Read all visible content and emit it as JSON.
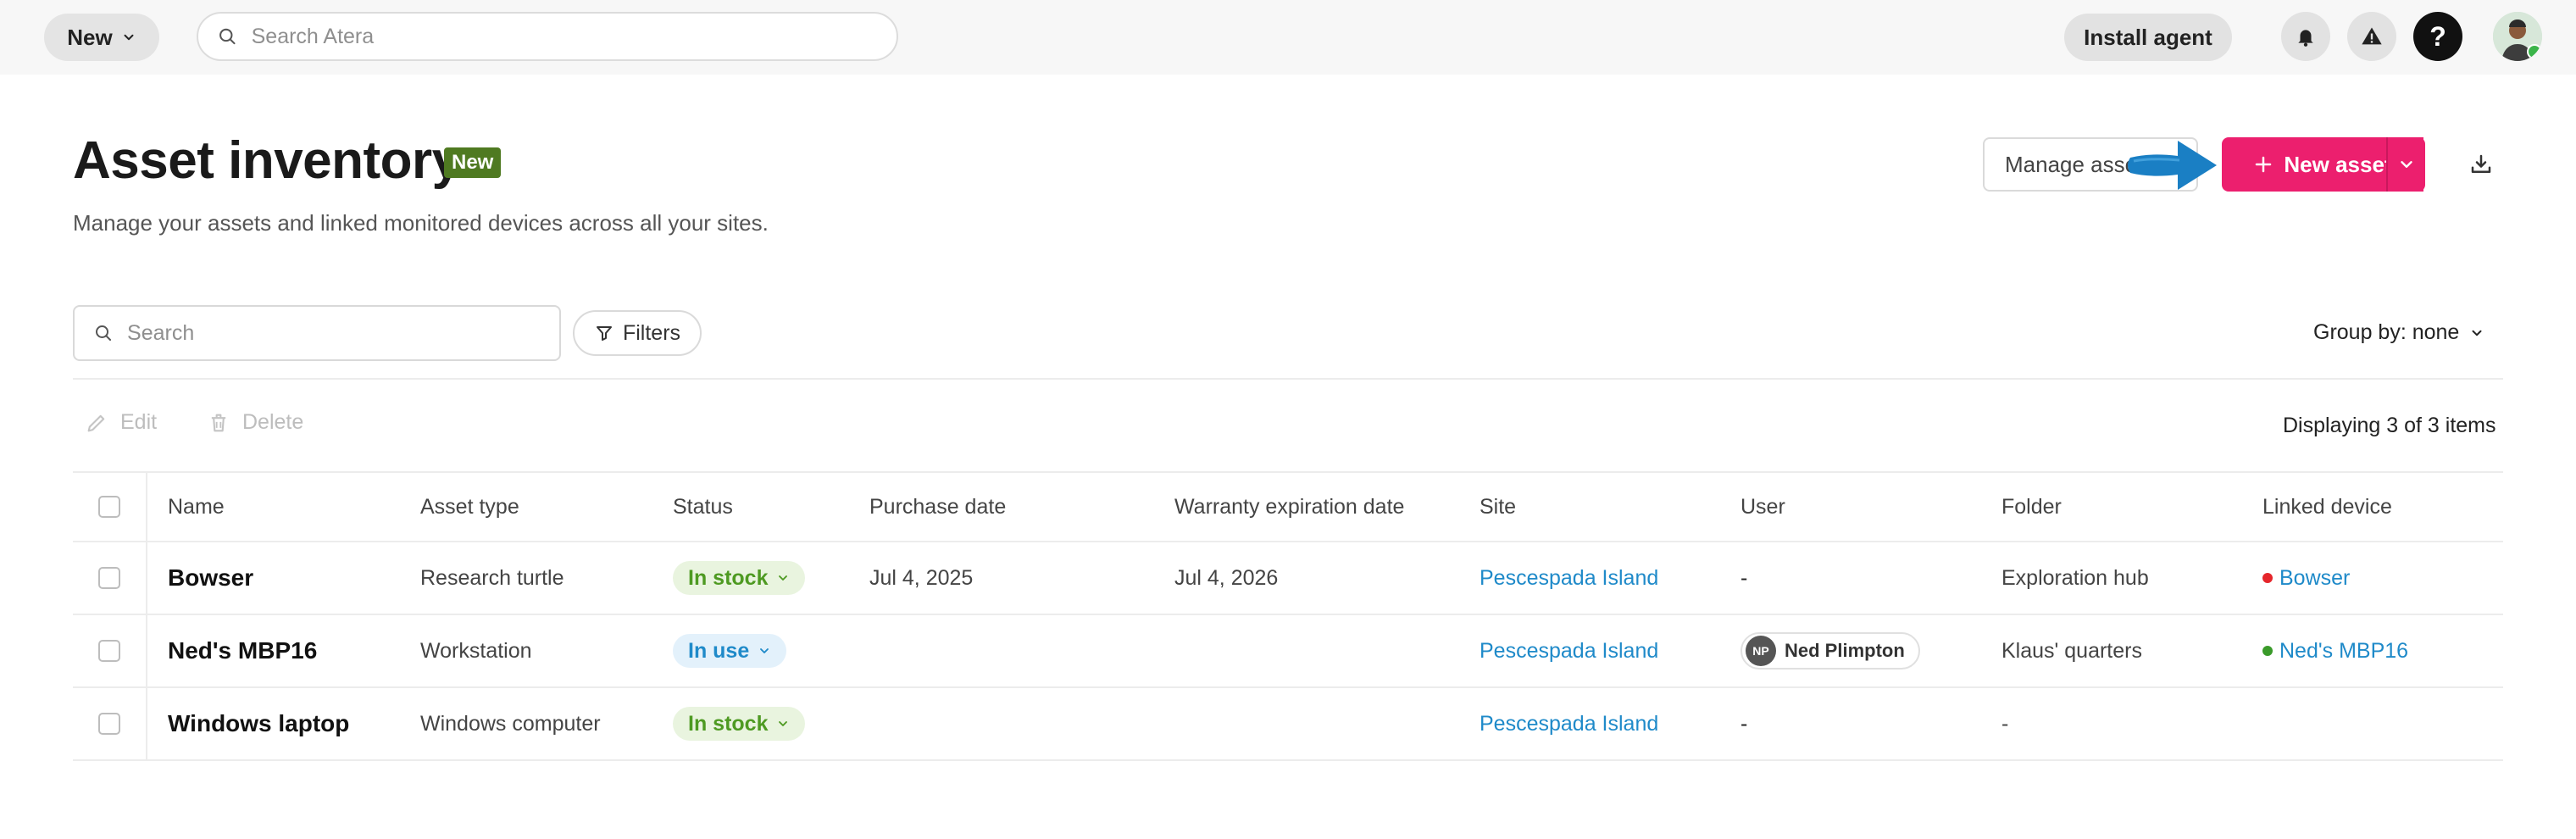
{
  "topbar": {
    "new_label": "New",
    "search_placeholder": "Search Atera",
    "install_label": "Install agent",
    "help_label": "?",
    "icons": [
      "chevron-down-icon",
      "search-icon",
      "bell-icon",
      "warning-icon",
      "help-icon",
      "user-avatar"
    ]
  },
  "header": {
    "title": "Asset inventory",
    "badge": "New",
    "subtitle": "Manage your assets and linked monitored devices across all your sites.",
    "manage_label": "Manage assets",
    "new_asset_label": "New asset"
  },
  "toolbar": {
    "search_placeholder": "Search",
    "filters_label": "Filters",
    "group_by_label": "Group by: none",
    "edit_label": "Edit",
    "delete_label": "Delete",
    "displaying_text": "Displaying 3 of 3 items"
  },
  "table": {
    "columns": [
      "Name",
      "Asset type",
      "Status",
      "Purchase date",
      "Warranty expiration date",
      "Site",
      "User",
      "Folder",
      "Linked device"
    ],
    "rows": [
      {
        "name": "Bowser",
        "asset_type": "Research turtle",
        "status": "In stock",
        "purchase_date": "Jul 4, 2025",
        "warranty": "Jul 4, 2026",
        "site": "Pescespada Island",
        "user": "-",
        "folder": "Exploration hub",
        "linked_device": "Bowser",
        "device_status_color": "#e5262b"
      },
      {
        "name": "Ned's MBP16",
        "asset_type": "Workstation",
        "status": "In use",
        "purchase_date": "",
        "warranty": "",
        "site": "Pescespada Island",
        "user_initials": "NP",
        "user": "Ned Plimpton",
        "folder": "Klaus' quarters",
        "linked_device": "Ned's MBP16",
        "device_status_color": "#3a9a2a"
      },
      {
        "name": "Windows laptop",
        "asset_type": "Windows computer",
        "status": "In stock",
        "purchase_date": "",
        "warranty": "",
        "site": "Pescespada Island",
        "user": "-",
        "folder": "-",
        "linked_device": ""
      }
    ]
  },
  "colors": {
    "accent": "#ec1f6e",
    "link": "#1f8ac9",
    "badge": "#4f7a21",
    "arrow": "#1a7fc4"
  }
}
